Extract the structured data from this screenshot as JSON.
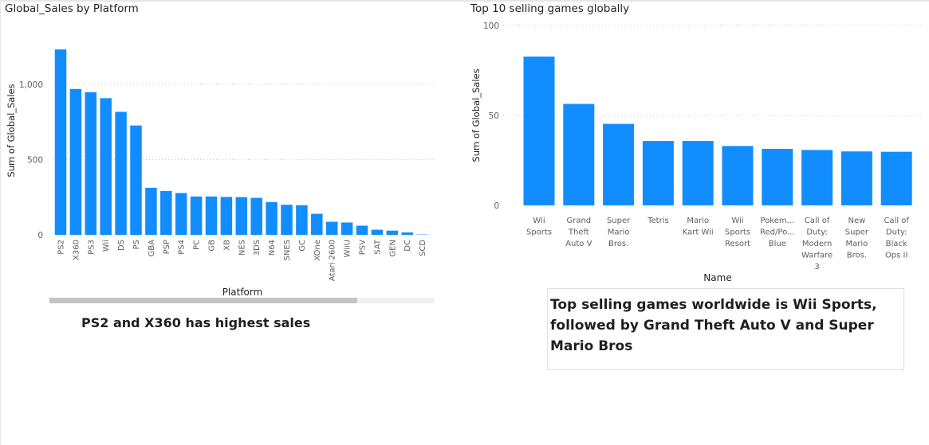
{
  "left_visual": {
    "title": "Global_Sales by Platform",
    "note": "PS2 and X360 has highest sales"
  },
  "right_visual": {
    "title": "Top 10 selling games globally",
    "note": "Top selling games worldwide is Wii Sports, followed by Grand Theft Auto V and Super Mario Bros"
  },
  "colors": {
    "bar": "#118DFF",
    "grid": "#c8c8c8",
    "axis_text": "#605e5c",
    "label_text": "#252423"
  },
  "chart_data": [
    {
      "type": "bar",
      "title": "Global_Sales by Platform",
      "xlabel": "Platform",
      "ylabel": "Sum of Global_Sales",
      "categories": [
        "PS2",
        "X360",
        "PS3",
        "Wii",
        "DS",
        "PS",
        "GBA",
        "PSP",
        "PS4",
        "PC",
        "GB",
        "XB",
        "NES",
        "3DS",
        "N64",
        "SNES",
        "GC",
        "XOne",
        "Atari 2600",
        "WiiU",
        "PSV",
        "SAT",
        "GEN",
        "DC",
        "SCD"
      ],
      "values": [
        1233,
        970,
        949,
        909,
        818,
        727,
        313,
        292,
        278,
        255,
        255,
        252,
        251,
        246,
        218,
        200,
        197,
        140,
        87,
        82,
        61,
        34,
        28,
        16,
        2
      ],
      "yticks": [
        "0",
        "500",
        "1,000"
      ],
      "ytick_values": [
        0,
        500,
        1000
      ],
      "ylim": [
        0,
        1350
      ],
      "grid": true,
      "scrollbar_visible_fraction": 0.8
    },
    {
      "type": "bar",
      "title": "Top 10 selling games globally",
      "xlabel": "Name",
      "ylabel": "Sum of Global_Sales",
      "categories": [
        "Wii Sports",
        "Grand Theft Auto V",
        "Super Mario Bros.",
        "Tetris",
        "Mario Kart Wii",
        "Wii Sports Resort",
        "Pokem... Red/Po... Blue",
        "Call of Duty: Modern Warfare 3",
        "New Super Mario Bros.",
        "Call of Duty: Black Ops II"
      ],
      "category_label_lines": [
        [
          "Wii",
          "Sports"
        ],
        [
          "Grand",
          "Theft",
          "Auto V"
        ],
        [
          "Super",
          "Mario",
          "Bros."
        ],
        [
          "Tetris"
        ],
        [
          "Mario",
          "Kart Wii"
        ],
        [
          "Wii",
          "Sports",
          "Resort"
        ],
        [
          "Pokem...",
          "Red/Po...",
          "Blue"
        ],
        [
          "Call of",
          "Duty:",
          "Modern",
          "Warfare",
          "3"
        ],
        [
          "New",
          "Super",
          "Mario",
          "Bros."
        ],
        [
          "Call of",
          "Duty:",
          "Black",
          "Ops II"
        ]
      ],
      "values": [
        82.7,
        56.4,
        45.3,
        35.8,
        35.8,
        33.0,
        31.4,
        30.8,
        30.0,
        29.8
      ],
      "yticks": [
        "0",
        "50",
        "100"
      ],
      "ytick_values": [
        0,
        50,
        100
      ],
      "ylim": [
        0,
        100
      ],
      "grid": true
    }
  ]
}
